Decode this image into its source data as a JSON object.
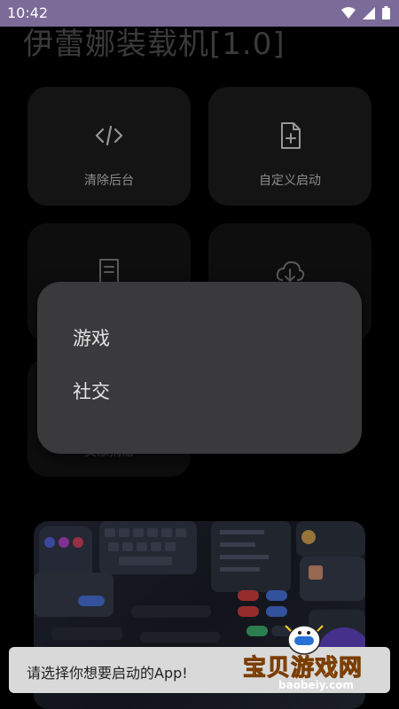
{
  "status_bar": {
    "time": "10:42"
  },
  "app": {
    "title": "伊蕾娜装载机[1.0]"
  },
  "tiles": [
    {
      "label": "清除后台",
      "icon": "code-icon"
    },
    {
      "label": "自定义启动",
      "icon": "file-add-icon"
    },
    {
      "label": "",
      "icon": "document-icon"
    },
    {
      "label": "",
      "icon": "cloud-download-icon"
    },
    {
      "label": "贡献捐赠",
      "icon": ""
    }
  ],
  "popup_menu": {
    "items": [
      "游戏",
      "社交"
    ]
  },
  "toast": {
    "message": "请选择你想要启动的App!"
  },
  "watermark": {
    "title": "宝贝游戏网",
    "url": "baobeiy.com"
  },
  "colors": {
    "status_bar": "#7b6b98",
    "tile": "#1f1f1f",
    "popup": "#3a3a3c",
    "toast": "#d9d9d9"
  }
}
